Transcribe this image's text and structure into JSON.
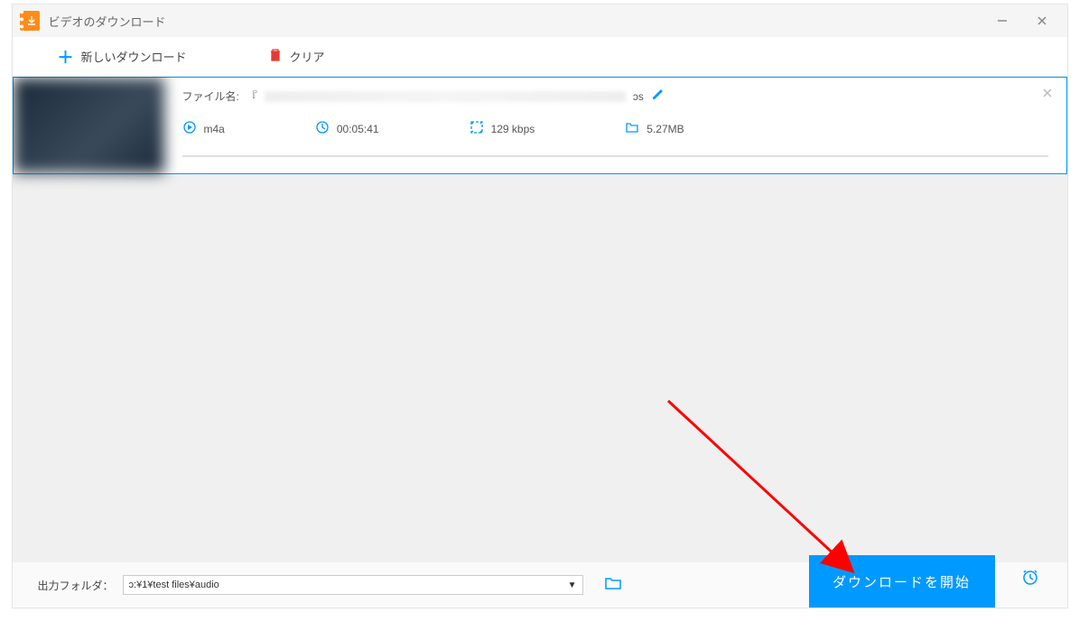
{
  "window": {
    "title": "ビデオのダウンロード"
  },
  "toolbar": {
    "new_download": "新しいダウンロード",
    "clear": "クリア"
  },
  "item": {
    "filename_label": "ファイル名:",
    "filename_prefix": "『",
    "filename_suffix": "ɔs",
    "format": "m4a",
    "duration": "00:05:41",
    "bitrate": "129 kbps",
    "size": "5.27MB"
  },
  "footer": {
    "output_label": "出力フォルダ：",
    "output_path": "ɔ:¥1¥test files¥audio",
    "start_button": "ダウンロードを開始"
  }
}
